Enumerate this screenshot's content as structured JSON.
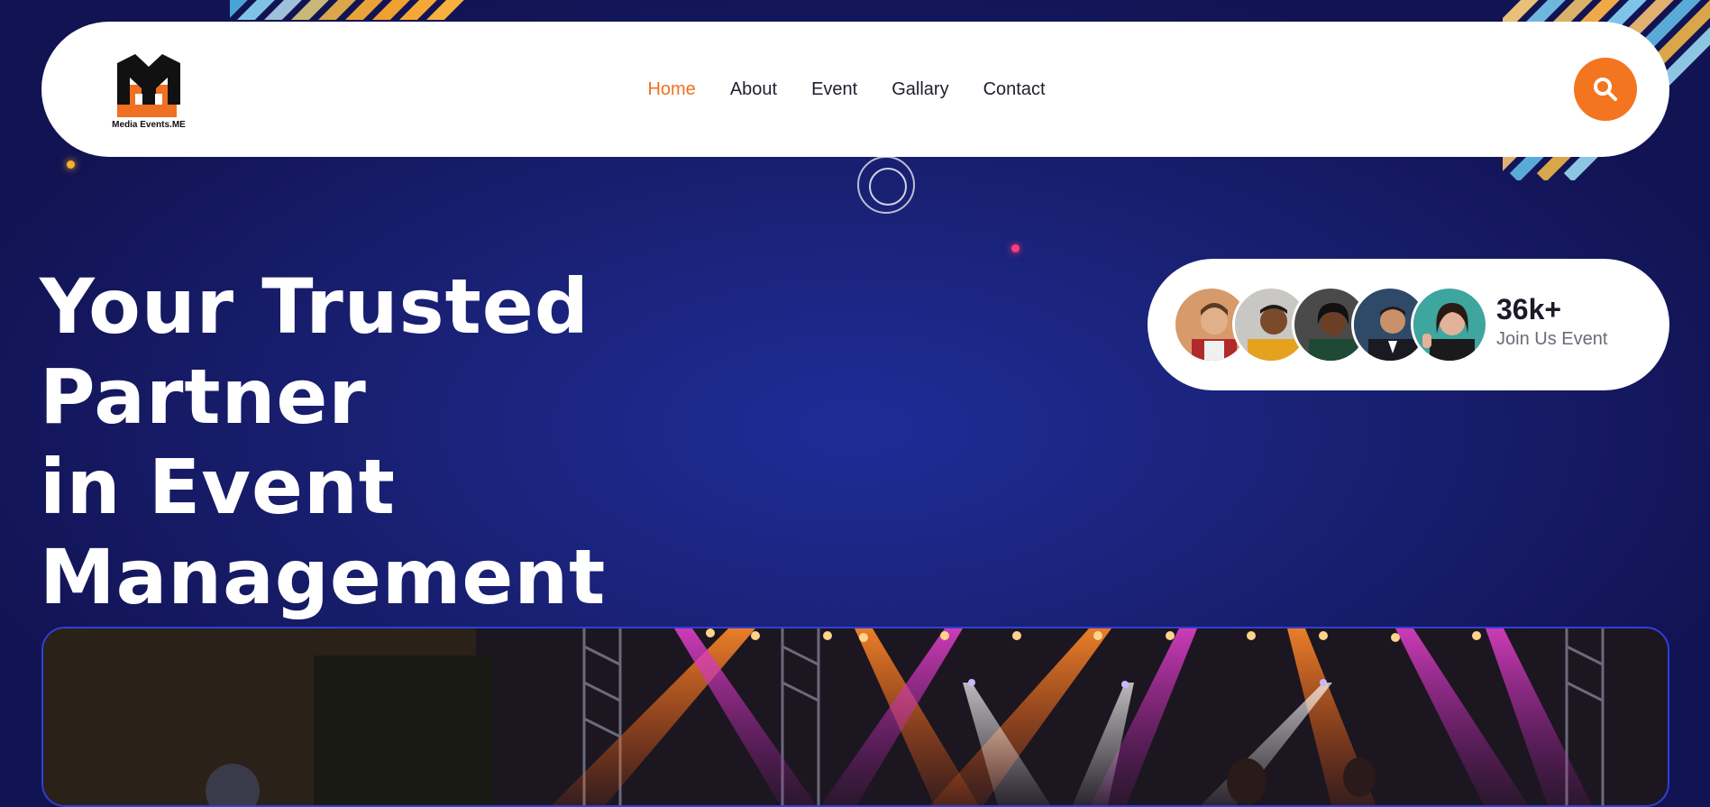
{
  "brand": {
    "logo_text": "Media Events.ME",
    "primary_color": "#f07021",
    "background_color": "#141660"
  },
  "nav": {
    "items": [
      {
        "label": "Home",
        "active": true
      },
      {
        "label": "About",
        "active": false
      },
      {
        "label": "Event",
        "active": false
      },
      {
        "label": "Gallary",
        "active": false
      },
      {
        "label": "Contact",
        "active": false
      }
    ],
    "search_icon": "search-icon"
  },
  "hero": {
    "title_line1": "Your Trusted Partner",
    "title_line2": "in Event",
    "title_line3": "Management"
  },
  "join": {
    "count": "36k+",
    "label": "Join Us Event",
    "avatar_icons": [
      "avatar-1",
      "avatar-2",
      "avatar-3",
      "avatar-4",
      "avatar-5"
    ]
  },
  "stage_image": {
    "icon": "concert-stage-photo"
  }
}
